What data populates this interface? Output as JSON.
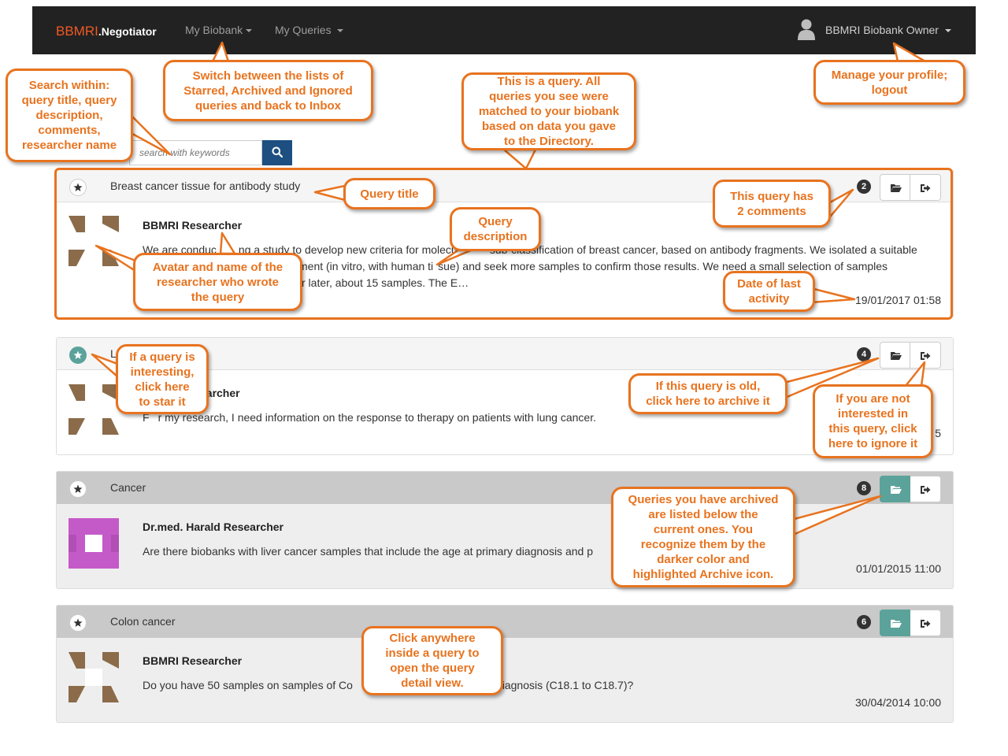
{
  "navbar": {
    "brand_prefix": "BBMRI",
    "brand_suffix": ".Negotiator",
    "my_biobank": "My Biobank",
    "my_queries": "My Queries",
    "user": "BBMRI Biobank Owner"
  },
  "search": {
    "placeholder": "search with keywords"
  },
  "queries": [
    {
      "title": "Breast cancer tissue for antibody study",
      "comments": "2",
      "researcher": "BBMRI Researcher",
      "description_line1": "We are conduc",
      "description_line1b": "ng a study to develop new criteria for molecul",
      "description_line1c": "sub-classification of breast cancer, based on antibody fragments. We isolated a suitable",
      "description_line2a": "ment (in vitro, with human ti",
      "description_line2b": "sue) and seek more samples to confirm those results. We need a small selection of samples",
      "description_line3": "r later, about 15 samples. The E…",
      "date": "19/01/2017 01:58",
      "starred": false,
      "archived": false
    },
    {
      "title_partial": "L",
      "comments": "4",
      "researcher_partial": "earcher",
      "description_partial_a": "F",
      "description_partial_b": "r my research, I need information on the response to therapy on patients with lung cancer.",
      "date_partial": "5",
      "starred": true,
      "archived": false
    },
    {
      "title": "Cancer",
      "comments": "8",
      "researcher": "Dr.med. Harald Researcher",
      "description": "Are there biobanks with liver cancer samples that include the age at primary diagnosis and p",
      "date": "01/01/2015 11:00",
      "starred": false,
      "archived": true
    },
    {
      "title": "Colon cancer",
      "comments": "6",
      "researcher": "BBMRI Researcher",
      "description_a": "Do you have 50 samples on samples of Co",
      "description_b": "diagnosis (C18.1 to C18.7)?",
      "date": "30/04/2014 10:00",
      "starred": false,
      "archived": true
    }
  ],
  "callouts": {
    "search": "Search within:\nquery title, query\ndescription,\ncomments,\nresearcher name",
    "switch": "Switch between the lists of\nStarred, Archived and Ignored\nqueries and back to Inbox",
    "is_query": "This is a query. All\nqueries you see were\nmatched to your biobank\nbased on data you gave\nto the Directory.",
    "profile": "Manage your profile;\nlogout",
    "query_title": "Query title",
    "comments": "This query has\n2 comments",
    "description": "Query\ndescription",
    "avatar": "Avatar and name of the\nresearcher who wrote\nthe query",
    "date": "Date of last\nactivity",
    "star": "If a query is\ninteresting,\nclick here\nto star it",
    "archive": "If this query is old,\nclick here to archive it",
    "ignore": "If you are not\ninterested in\nthis query, click\nhere to ignore it",
    "archived": "Queries you have archived\nare listed below the\ncurrent ones. You\nrecognize them by the\ndarker color and\nhighlighted Archive icon.",
    "click": "Click anywhere\ninside a query to\nopen the query\ndetail view."
  },
  "colors": {
    "accent": "#e8731f",
    "navbar": "#222222",
    "teal": "#5ba29a",
    "search_button": "#1d4f80",
    "avatar_brown": "#8b6b4a",
    "avatar_magenta": "#c45ac8"
  }
}
